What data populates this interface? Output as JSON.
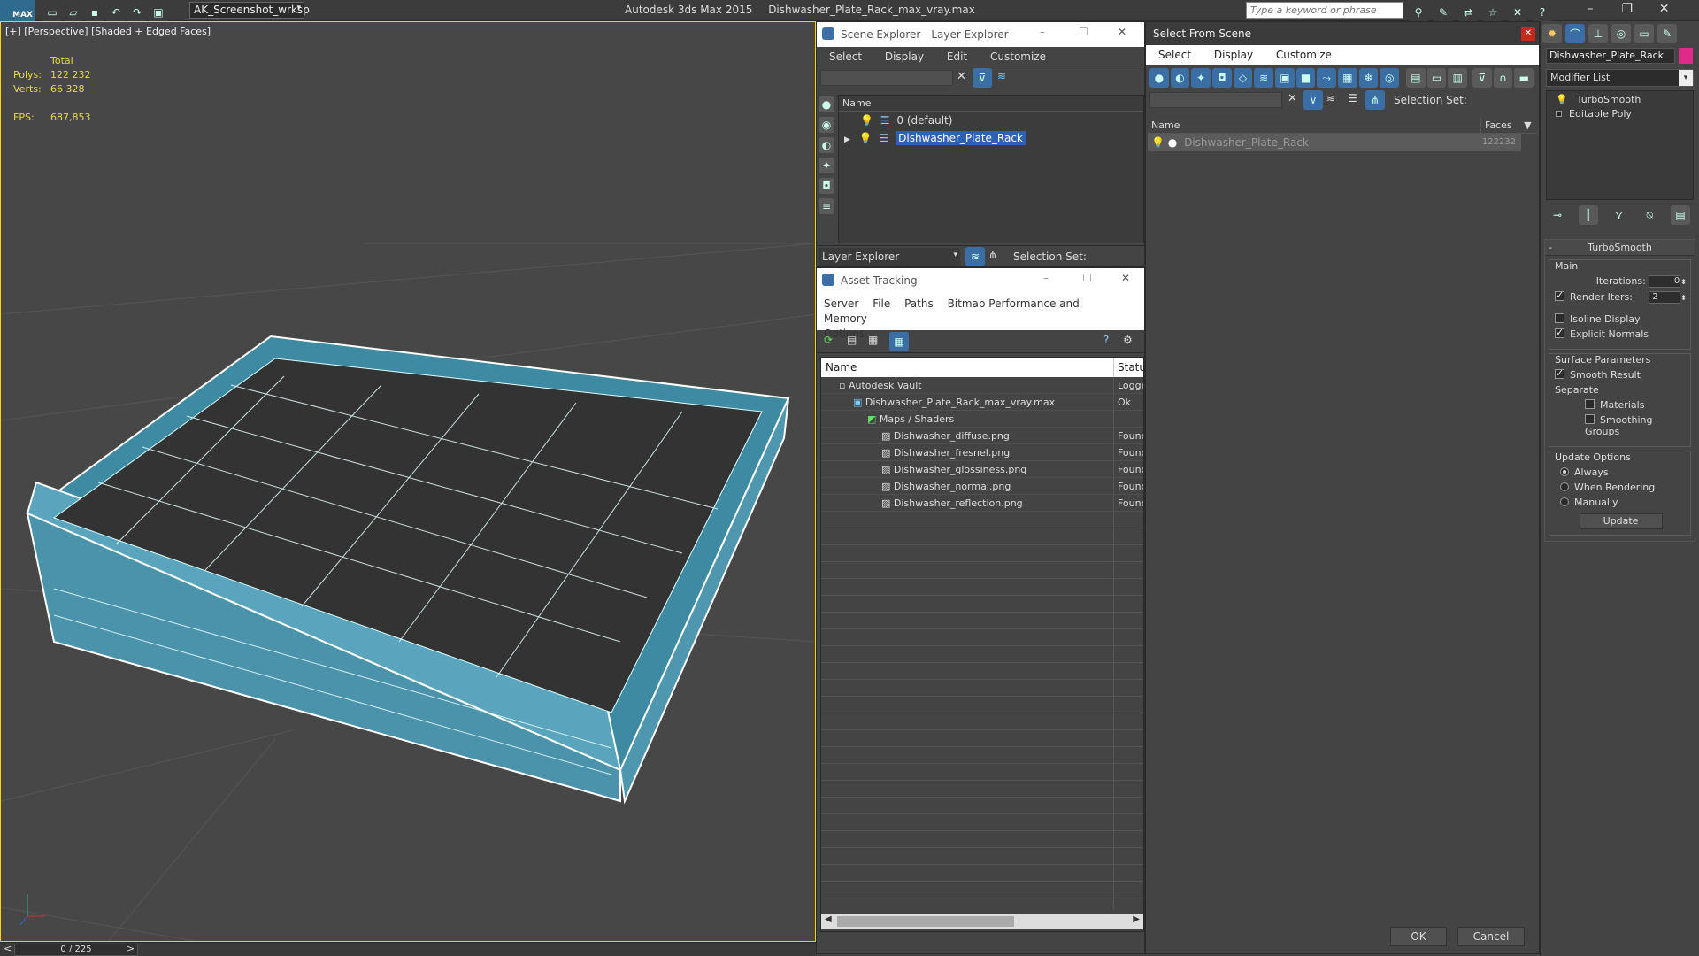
{
  "app": {
    "title": "Autodesk 3ds Max  2015",
    "file": "Dishwasher_Plate_Rack_max_vray.max",
    "workspace": "AK_Screenshot_wrksp",
    "search_placeholder": "Type a keyword or phrase",
    "logo": "MAX"
  },
  "viewport": {
    "label": "[+] [Perspective] [Shaded + Edged Faces]",
    "stats_total": "Total",
    "polys_label": "Polys:",
    "polys_value": "122 232",
    "verts_label": "Verts:",
    "verts_value": "66 328",
    "fps_label": "FPS:",
    "fps_value": "687,853",
    "timeline": "0 / 225",
    "prev": "<",
    "next": ">"
  },
  "scene_explorer": {
    "title": "Scene Explorer - Layer Explorer",
    "menu": [
      "Select",
      "Display",
      "Edit",
      "Customize"
    ],
    "col_name": "Name",
    "layers": [
      "0 (default)",
      "Dishwasher_Plate_Rack"
    ],
    "footer_label": "Layer Explorer",
    "selection_set": "Selection Set:"
  },
  "asset_tracking": {
    "title": "Asset Tracking",
    "menu": [
      "Server",
      "File",
      "Paths",
      "Bitmap Performance and Memory"
    ],
    "menu2": "Options",
    "col_name": "Name",
    "col_status": "Status",
    "rows": [
      {
        "name": "Autodesk Vault",
        "status": "Logge"
      },
      {
        "name": "Dishwasher_Plate_Rack_max_vray.max",
        "status": "Ok"
      },
      {
        "name": "Maps / Shaders",
        "status": ""
      },
      {
        "name": "Dishwasher_diffuse.png",
        "status": "Found"
      },
      {
        "name": "Dishwasher_fresnel.png",
        "status": "Found"
      },
      {
        "name": "Dishwasher_glossiness.png",
        "status": "Found"
      },
      {
        "name": "Dishwasher_normal.png",
        "status": "Found"
      },
      {
        "name": "Dishwasher_reflection.png",
        "status": "Found"
      }
    ]
  },
  "select_from_scene": {
    "title": "Select From Scene",
    "menu": [
      "Select",
      "Display",
      "Customize"
    ],
    "selection_set": "Selection Set:",
    "col_name": "Name",
    "col_faces": "Faces",
    "object_name": "Dishwasher_Plate_Rack",
    "object_faces": "122232",
    "ok": "OK",
    "cancel": "Cancel"
  },
  "command_panel": {
    "object_name": "Dishwasher_Plate_Rack",
    "modifier_list": "Modifier List",
    "stack": [
      "TurboSmooth",
      "Editable Poly"
    ],
    "rollout_title": "TurboSmooth",
    "main_label": "Main",
    "iterations_label": "Iterations:",
    "iterations_value": "0",
    "render_iters_label": "Render Iters:",
    "render_iters_value": "2",
    "isoline": "Isoline Display",
    "explicit_normals": "Explicit Normals",
    "surface_params": "Surface Parameters",
    "smooth_result": "Smooth Result",
    "separate": "Separate",
    "materials": "Materials",
    "smoothing_groups": "Smoothing Groups",
    "update_options": "Update Options",
    "always": "Always",
    "when_rendering": "When Rendering",
    "manually": "Manually",
    "update_btn": "Update"
  },
  "colors": {
    "accent": "#3a6ea5",
    "selection": "#2f5fb6",
    "wire": "#ffffff",
    "mesh": "#4f9bb3",
    "stats_yellow": "#e7d84a"
  }
}
